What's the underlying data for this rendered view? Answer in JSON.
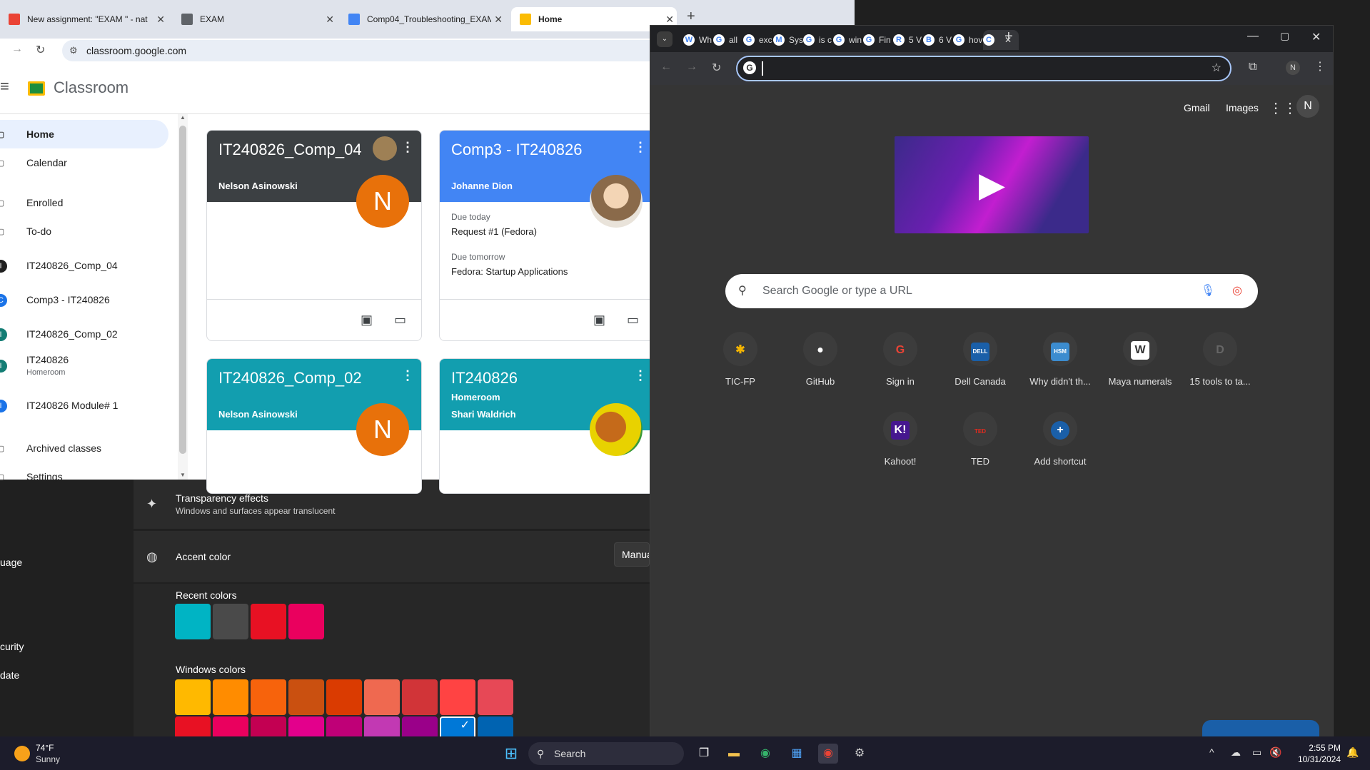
{
  "settings": {
    "side_items": [
      "uage",
      "curity",
      "date"
    ],
    "transparency_title": "Transparency effects",
    "transparency_sub": "Windows and surfaces appear translucent",
    "accent_title": "Accent color",
    "accent_mode": "Manual",
    "recent_label": "Recent colors",
    "recent_colors": [
      "#00b4c4",
      "#4a4a4a",
      "#e81123",
      "#ea005e"
    ],
    "windows_label": "Windows colors",
    "windows_colors_row1": [
      "#ffb900",
      "#ff8c00",
      "#f7630c",
      "#ca5010",
      "#da3b01",
      "#ef6950",
      "#d13438",
      "#ff4343",
      "#e74856"
    ],
    "windows_colors_row2": [
      "#e81123",
      "#ea005e",
      "#c30052",
      "#e3008c",
      "#bf0077",
      "#c239b3",
      "#9a0089",
      "#0078d7",
      "#0063b1"
    ]
  },
  "classroom_window": {
    "tabs": [
      {
        "label": "New assignment: \"EXAM \" - nat",
        "favicon_color": "#ea4335"
      },
      {
        "label": "EXAM",
        "favicon_color": "#5f6368"
      },
      {
        "label": "Comp04_Troubleshooting_EXAM",
        "favicon_color": "#4285f4"
      },
      {
        "label": "Home",
        "favicon_color": "#fbbc04"
      }
    ],
    "url": "classroom.google.com",
    "app_name": "Classroom",
    "sidebar": [
      {
        "label": "Home",
        "icon": "home-icon"
      },
      {
        "label": "Calendar",
        "icon": "calendar-icon"
      },
      {
        "label": "Enrolled",
        "icon": "school-icon"
      },
      {
        "label": "To-do",
        "icon": "checklist-icon"
      },
      {
        "label": "IT240826_Comp_04",
        "icon": "class-avatar-icon",
        "color": "#1f1f1f",
        "letter": "I"
      },
      {
        "label": "Comp3 - IT240826",
        "icon": "class-avatar-icon",
        "color": "#1a73e8",
        "letter": "C"
      },
      {
        "label": "IT240826_Comp_02",
        "icon": "class-avatar-icon",
        "color": "#137d74",
        "letter": "I"
      },
      {
        "label": "IT240826",
        "sub": "Homeroom",
        "icon": "class-avatar-icon",
        "color": "#137d74",
        "letter": "I"
      },
      {
        "label": "IT240826 Module# 1",
        "icon": "class-avatar-icon",
        "color": "#1a73e8",
        "letter": "I"
      },
      {
        "label": "Archived classes",
        "icon": "archive-icon"
      },
      {
        "label": "Settings",
        "icon": "gear-icon"
      }
    ],
    "cards": [
      {
        "title": "IT240826_Comp_04",
        "teacher": "Nelson Asinowski",
        "color": "#3c4043",
        "avatar": "N",
        "avatar_color": "#e8710a"
      },
      {
        "title": "Comp3 - IT240826",
        "teacher": "Johanne Dion",
        "color": "#4285f4",
        "due_today_label": "Due today",
        "due_today": "Request #1 (Fedora)",
        "due_tomorrow_label": "Due tomorrow",
        "due_tomorrow": "Fedora: Startup Applications"
      },
      {
        "title": "IT240826_Comp_02",
        "teacher": "Nelson Asinowski",
        "color": "#129eaf",
        "avatar": "N",
        "avatar_color": "#e8710a"
      },
      {
        "title": "IT240826",
        "section": "Homeroom",
        "teacher": "Shari Waldrich",
        "color": "#129eaf"
      }
    ]
  },
  "dark_window": {
    "tabs": [
      {
        "label": "Wh",
        "fav": "W"
      },
      {
        "label": "all",
        "fav": "G"
      },
      {
        "label": "exc",
        "fav": "G"
      },
      {
        "label": "Sys",
        "fav": "M"
      },
      {
        "label": "is c",
        "fav": "G"
      },
      {
        "label": "win",
        "fav": "G"
      },
      {
        "label": "Fin",
        "fav": "G"
      },
      {
        "label": "5 V",
        "fav": "R"
      },
      {
        "label": "6 V",
        "fav": "B"
      },
      {
        "label": "hov",
        "fav": "G"
      },
      {
        "label": "",
        "fav": "C"
      }
    ],
    "top_links": [
      "Gmail",
      "Images"
    ],
    "profile_letter": "N",
    "search_placeholder": "Search Google or type a URL",
    "shortcuts": [
      {
        "label": "TIC-FP",
        "glyph": "✱"
      },
      {
        "label": "GitHub",
        "glyph": "●"
      },
      {
        "label": "Sign in",
        "glyph": "G"
      },
      {
        "label": "Dell Canada",
        "glyph": "DELL"
      },
      {
        "label": "Why didn't th...",
        "glyph": "HSM"
      },
      {
        "label": "Maya numerals",
        "glyph": "W"
      },
      {
        "label": "15 tools to ta...",
        "glyph": "D"
      },
      {
        "label": "Kahoot!",
        "glyph": "K!"
      },
      {
        "label": "TED",
        "glyph": "TED"
      },
      {
        "label": "Add shortcut",
        "glyph": "+"
      }
    ]
  },
  "taskbar": {
    "temperature": "74°F",
    "weather": "Sunny",
    "search_label": "Search",
    "time": "2:55 PM",
    "date": "10/31/2024"
  }
}
